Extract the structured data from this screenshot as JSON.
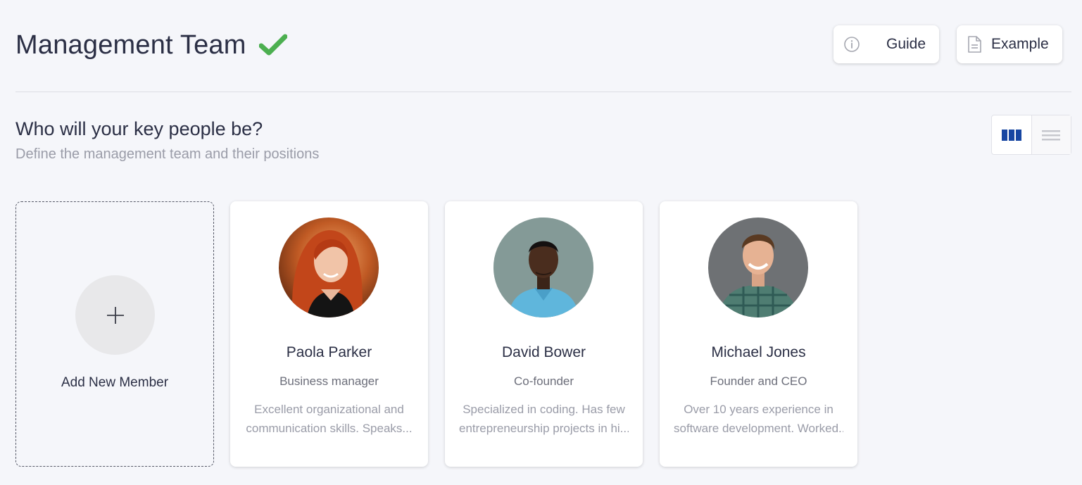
{
  "header": {
    "title": "Management Team",
    "guide_label": "Guide",
    "example_label": "Example",
    "colors": {
      "check": "#4caf50",
      "accent": "#1746a2"
    }
  },
  "section": {
    "title": "Who will your key people be?",
    "subtitle": "Define the management team and their positions"
  },
  "view_toggle": {
    "selected": "grid",
    "options": [
      "grid-view-icon",
      "list-view-icon"
    ]
  },
  "add_card": {
    "label": "Add New Member",
    "icon": "plus-icon"
  },
  "members": [
    {
      "name": "Paola Parker",
      "role": "Business manager",
      "description_line1": "Excellent organizational and",
      "description_line2": "communication skills. Speaks..."
    },
    {
      "name": "David Bower",
      "role": "Co-founder",
      "description_line1": "Specialized in coding. Has few",
      "description_line2": "entrepreneurship projects in hi..."
    },
    {
      "name": "Michael Jones",
      "role": "Founder and CEO",
      "description_line1": "Over 10 years experience in",
      "description_line2": "software development. Worked.."
    }
  ]
}
